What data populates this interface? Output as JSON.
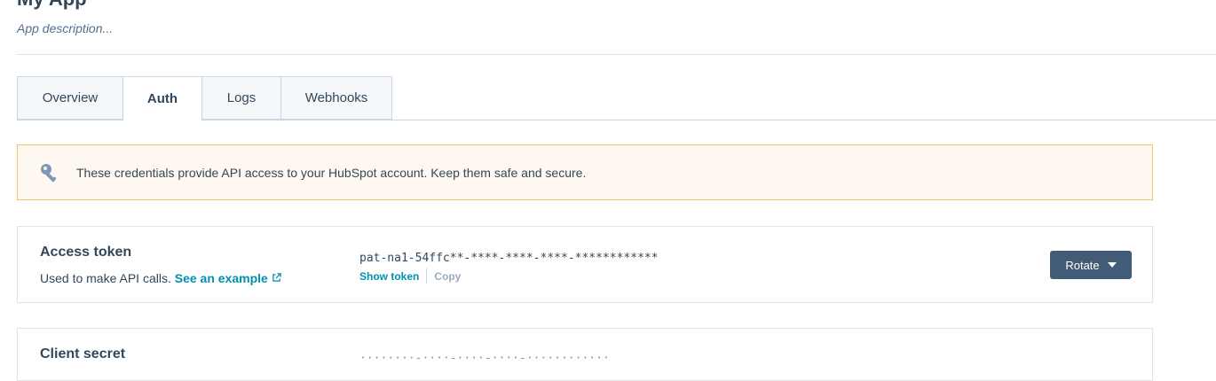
{
  "app": {
    "title": "My App",
    "description": "App description..."
  },
  "tabs": [
    {
      "label": "Overview",
      "active": false
    },
    {
      "label": "Auth",
      "active": true
    },
    {
      "label": "Logs",
      "active": false
    },
    {
      "label": "Webhooks",
      "active": false
    }
  ],
  "alert": {
    "icon": "key-icon",
    "text": "These credentials provide API access to your HubSpot account. Keep them safe and secure."
  },
  "access_token": {
    "title": "Access token",
    "description": "Used to make API calls.",
    "link_label": "See an example",
    "value": "pat-na1-54ffc**-****-****-****-************",
    "show_label": "Show token",
    "copy_label": "Copy",
    "rotate_label": "Rotate"
  },
  "client_secret": {
    "title": "Client secret",
    "value": "········-····-····-····-············"
  },
  "colors": {
    "accent_link": "#0091ae",
    "button_bg": "#425b76",
    "alert_bg": "#fef8f0",
    "alert_border": "#f5c26b"
  }
}
